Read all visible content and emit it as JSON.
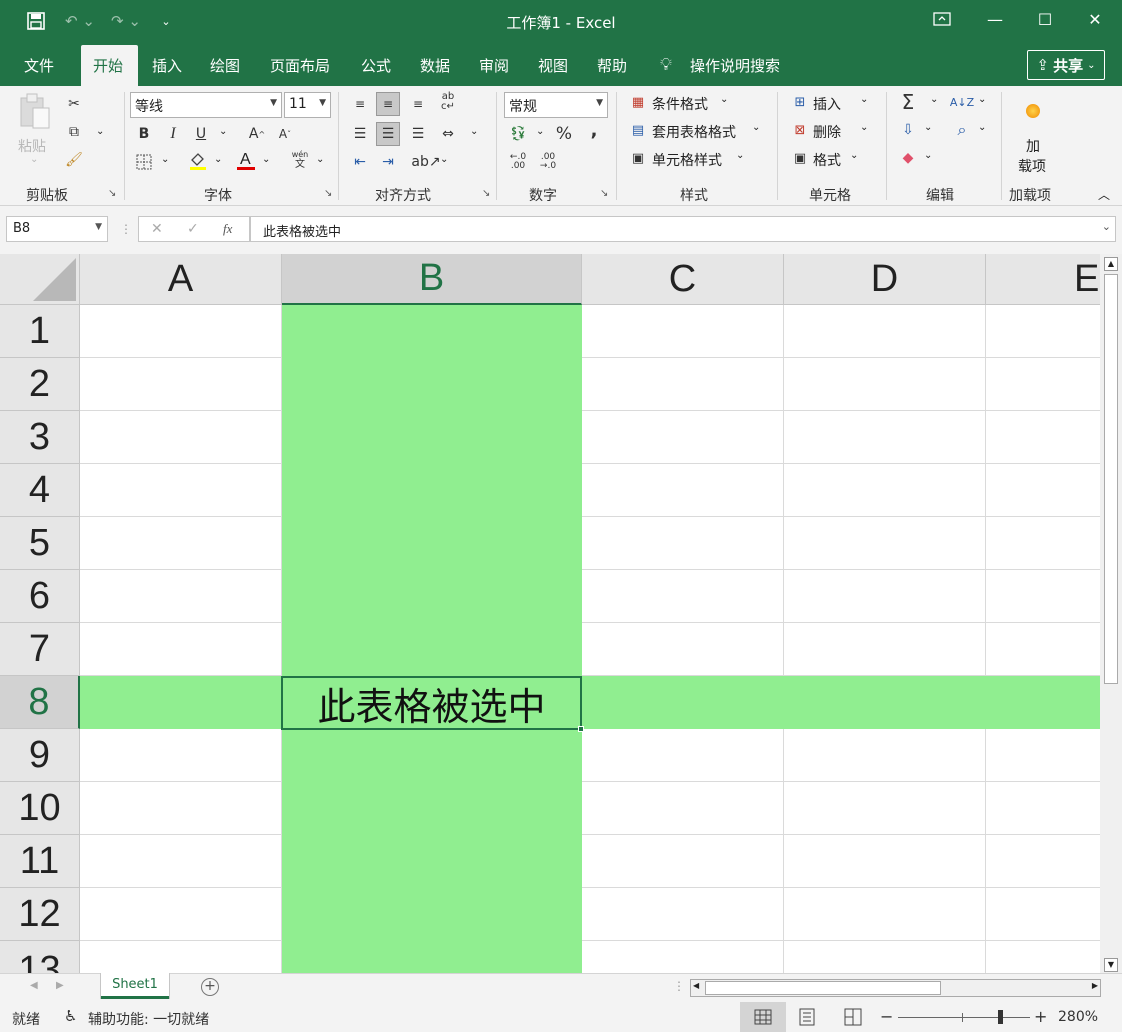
{
  "window": {
    "title": "工作簿1  -  Excel"
  },
  "menu": {
    "tabs": [
      "文件",
      "开始",
      "插入",
      "绘图",
      "页面布局",
      "公式",
      "数据",
      "审阅",
      "视图",
      "帮助"
    ],
    "search": "操作说明搜索",
    "share": "共享"
  },
  "ribbon": {
    "clipboard": {
      "paste": "粘贴",
      "label": "剪贴板"
    },
    "font": {
      "name": "等线",
      "size": "11",
      "label": "字体",
      "bold": "B",
      "italic": "I",
      "underline": "U"
    },
    "alignment": {
      "label": "对齐方式"
    },
    "number": {
      "format": "常规",
      "label": "数字",
      "percent": "%",
      "comma": ","
    },
    "styles": {
      "conditional": "条件格式",
      "table": "套用表格格式",
      "cell": "单元格样式",
      "label": "样式"
    },
    "cells": {
      "insert": "插入",
      "delete": "删除",
      "format": "格式",
      "label": "单元格"
    },
    "editing": {
      "label": "编辑"
    },
    "addins": {
      "button": "加\n载项",
      "button_line1": "加",
      "button_line2": "载项",
      "label": "加载项"
    }
  },
  "formula_bar": {
    "name_box": "B8",
    "content": "此表格被选中"
  },
  "grid": {
    "columns": [
      "A",
      "B",
      "C",
      "D",
      "E"
    ],
    "rows": [
      "1",
      "2",
      "3",
      "4",
      "5",
      "6",
      "7",
      "8",
      "9",
      "10",
      "11",
      "12",
      "13"
    ],
    "selected_cell_text": "此表格被选中",
    "highlight_color": "#90ee90"
  },
  "sheets": {
    "tabs": [
      "Sheet1"
    ]
  },
  "status": {
    "ready": "就绪",
    "accessibility": "辅助功能: 一切就绪",
    "zoom": "280%"
  }
}
